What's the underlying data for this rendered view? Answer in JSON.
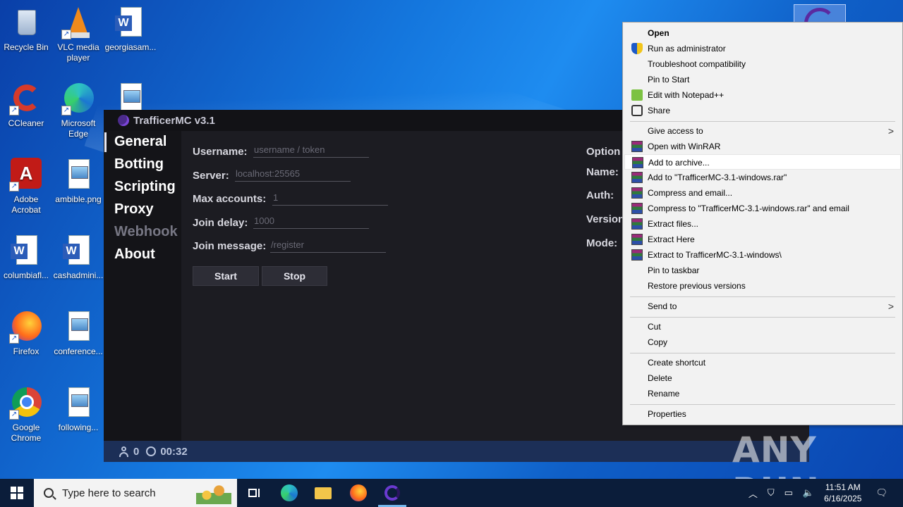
{
  "desktop": {
    "icons": [
      {
        "label": "Recycle Bin"
      },
      {
        "label": "VLC media player"
      },
      {
        "label": "georgiasam..."
      },
      {
        "label": "CCleaner"
      },
      {
        "label": "Microsoft Edge"
      },
      {
        "label": "Adobe Acrobat"
      },
      {
        "label": "ambible.png"
      },
      {
        "label": "columbiafl..."
      },
      {
        "label": "cashadmini..."
      },
      {
        "label": "Firefox"
      },
      {
        "label": "conference..."
      },
      {
        "label": "Google Chrome"
      },
      {
        "label": "following..."
      }
    ]
  },
  "app": {
    "title": "TrafficerMC v3.1",
    "nav": [
      {
        "label": "General",
        "active": true
      },
      {
        "label": "Botting"
      },
      {
        "label": "Scripting"
      },
      {
        "label": "Proxy"
      },
      {
        "label": "Webhook",
        "disabled": true
      },
      {
        "label": "About"
      }
    ],
    "fields": {
      "username": {
        "label": "Username:",
        "placeholder": "username / token"
      },
      "server": {
        "label": "Server:",
        "placeholder": "localhost:25565"
      },
      "max_accounts": {
        "label": "Max accounts:",
        "placeholder": "1"
      },
      "join_delay": {
        "label": "Join delay:",
        "placeholder": "1000"
      },
      "join_message": {
        "label": "Join message:",
        "placeholder": "/register"
      }
    },
    "buttons": {
      "start": "Start",
      "stop": "Stop"
    },
    "options": {
      "heading": "Option",
      "name": "Name:",
      "auth": "Auth:",
      "version": "Version",
      "mode": "Mode:"
    },
    "status": {
      "accounts": "0",
      "timer": "00:32"
    }
  },
  "context_menu": {
    "items": [
      {
        "label": "Open",
        "bold": true
      },
      {
        "label": "Run as administrator",
        "icon": "shield-icon"
      },
      {
        "label": "Troubleshoot compatibility"
      },
      {
        "label": "Pin to Start"
      },
      {
        "label": "Edit with Notepad++",
        "icon": "notepad-plus-plus-icon"
      },
      {
        "label": "Share",
        "icon": "share-icon"
      },
      {
        "label": "Give access to",
        "submenu": true
      },
      {
        "label": "Open with WinRAR",
        "icon": "winrar-icon"
      },
      {
        "label": "Add to archive...",
        "icon": "winrar-icon",
        "hover": true
      },
      {
        "label": "Add to \"TrafficerMC-3.1-windows.rar\"",
        "icon": "winrar-icon"
      },
      {
        "label": "Compress and email...",
        "icon": "winrar-icon"
      },
      {
        "label": "Compress to \"TrafficerMC-3.1-windows.rar\" and email",
        "icon": "winrar-icon"
      },
      {
        "label": "Extract files...",
        "icon": "winrar-icon"
      },
      {
        "label": "Extract Here",
        "icon": "winrar-icon"
      },
      {
        "label": "Extract to TrafficerMC-3.1-windows\\",
        "icon": "winrar-icon"
      },
      {
        "label": "Pin to taskbar"
      },
      {
        "label": "Restore previous versions"
      },
      {
        "label": "Send to",
        "submenu": true
      },
      {
        "label": "Cut"
      },
      {
        "label": "Copy"
      },
      {
        "label": "Create shortcut"
      },
      {
        "label": "Delete"
      },
      {
        "label": "Rename"
      },
      {
        "label": "Properties"
      }
    ]
  },
  "watermark": "ANY RUN",
  "taskbar": {
    "search_placeholder": "Type here to search",
    "time": "11:51 AM",
    "date": "6/16/2025"
  }
}
